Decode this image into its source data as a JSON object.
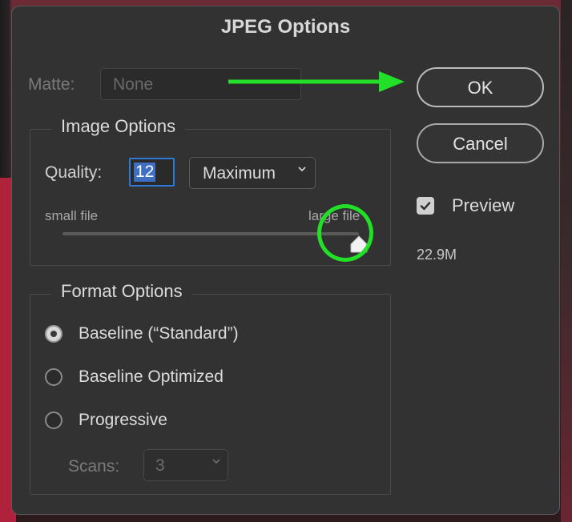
{
  "dialog": {
    "title": "JPEG Options"
  },
  "matte": {
    "label": "Matte:",
    "value": "None"
  },
  "image_options": {
    "legend": "Image Options",
    "quality_label": "Quality:",
    "quality_value": "12",
    "quality_preset": "Maximum",
    "slider_min_label": "small file",
    "slider_max_label": "large file",
    "slider_value": 12,
    "slider_max": 12
  },
  "format_options": {
    "legend": "Format Options",
    "options": [
      {
        "label": "Baseline (“Standard”)",
        "selected": true
      },
      {
        "label": "Baseline Optimized",
        "selected": false
      },
      {
        "label": "Progressive",
        "selected": false
      }
    ],
    "scans_label": "Scans:",
    "scans_value": "3"
  },
  "buttons": {
    "ok": "OK",
    "cancel": "Cancel"
  },
  "preview": {
    "label": "Preview",
    "checked": true,
    "file_size": "22.9M"
  },
  "colors": {
    "annotation": "#22e028",
    "focus": "#2d79d6"
  },
  "icons": {
    "preview_check": "checkmark-icon",
    "select_chevron": "chevron-down-icon"
  }
}
